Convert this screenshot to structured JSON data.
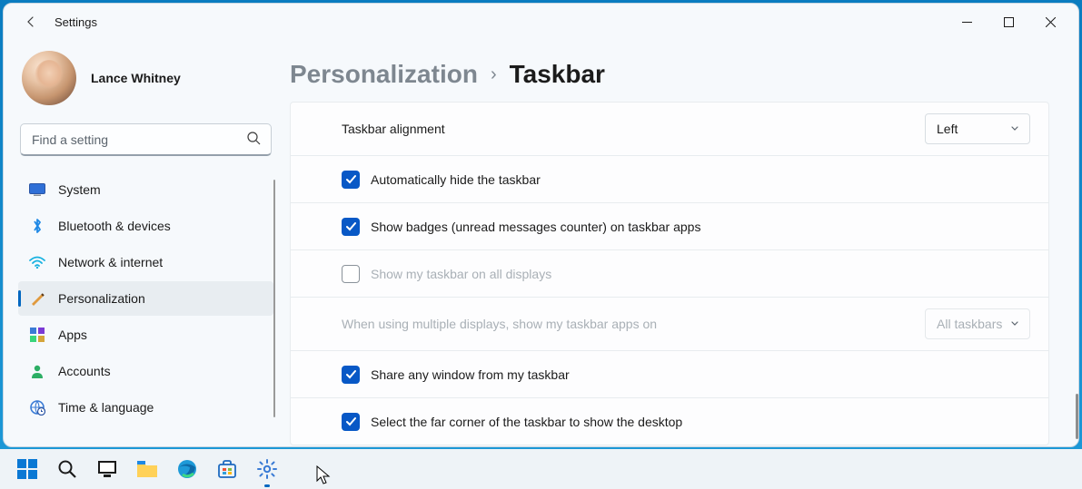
{
  "window": {
    "title": "Settings"
  },
  "user": {
    "name": "Lance Whitney"
  },
  "search": {
    "placeholder": "Find a setting"
  },
  "nav": {
    "items": [
      {
        "id": "system",
        "label": "System"
      },
      {
        "id": "bluetooth",
        "label": "Bluetooth & devices"
      },
      {
        "id": "network",
        "label": "Network & internet"
      },
      {
        "id": "personalization",
        "label": "Personalization"
      },
      {
        "id": "apps",
        "label": "Apps"
      },
      {
        "id": "accounts",
        "label": "Accounts"
      },
      {
        "id": "time",
        "label": "Time & language"
      }
    ],
    "active": "personalization"
  },
  "breadcrumb": {
    "parent": "Personalization",
    "current": "Taskbar"
  },
  "settings": {
    "alignment": {
      "label": "Taskbar alignment",
      "value": "Left"
    },
    "auto_hide": {
      "label": "Automatically hide the taskbar",
      "checked": true
    },
    "badges": {
      "label": "Show badges (unread messages counter) on taskbar apps",
      "checked": true
    },
    "all_displays": {
      "label": "Show my taskbar on all displays",
      "checked": false,
      "disabled": true
    },
    "multi_display": {
      "label": "When using multiple displays, show my taskbar apps on",
      "value": "All taskbars",
      "disabled": true
    },
    "share_window": {
      "label": "Share any window from my taskbar",
      "checked": true
    },
    "far_corner": {
      "label": "Select the far corner of the taskbar to show the desktop",
      "checked": true
    }
  },
  "colors": {
    "accent": "#0067c0",
    "checkbox": "#0858c6"
  }
}
